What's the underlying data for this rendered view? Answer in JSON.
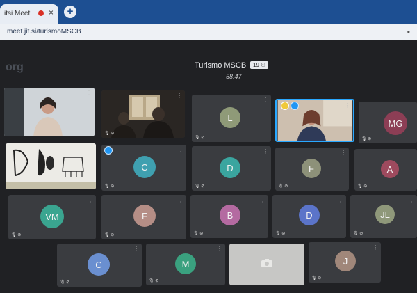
{
  "browser": {
    "tab_title": "itsi Meet",
    "close_icon": "×",
    "new_tab_icon": "+",
    "url": "meet.jit.si/turismoMSCB",
    "menu_icon": "•"
  },
  "meeting": {
    "logo": "org",
    "room_name": "Turismo MSCB",
    "participant_count": "19",
    "elapsed": "58:47",
    "mute_label": "🎙 ⊘",
    "more_icon": "⋮"
  },
  "colors": {
    "accent": "#1d4f92",
    "tile_bg": "#3a3c40",
    "active_border": "#29a8ff"
  },
  "participants": [
    {
      "id": "p1",
      "type": "video",
      "desc": "woman-webcam"
    },
    {
      "id": "p2",
      "type": "video",
      "desc": "dark-room"
    },
    {
      "id": "p3",
      "type": "avatar",
      "initials": "L",
      "color": "#8f9a78"
    },
    {
      "id": "p4",
      "type": "video",
      "desc": "woman-active-speaker"
    },
    {
      "id": "p5",
      "type": "avatar",
      "initials": "MG",
      "color": "#8c3e55"
    },
    {
      "id": "p6",
      "type": "video",
      "desc": "drawing-sheet"
    },
    {
      "id": "p7",
      "type": "avatar",
      "initials": "C",
      "color": "#3fa0b0"
    },
    {
      "id": "p8",
      "type": "avatar",
      "initials": "D",
      "color": "#3aa59f"
    },
    {
      "id": "p9",
      "type": "avatar",
      "initials": "F",
      "color": "#8d9179"
    },
    {
      "id": "p10",
      "type": "avatar",
      "initials": "A",
      "color": "#9e4a5e"
    },
    {
      "id": "p11",
      "type": "avatar",
      "initials": "VM",
      "color": "#3aa590"
    },
    {
      "id": "p12",
      "type": "avatar",
      "initials": "F",
      "color": "#b58e86"
    },
    {
      "id": "p13",
      "type": "avatar",
      "initials": "B",
      "color": "#b46aa1"
    },
    {
      "id": "p14",
      "type": "avatar",
      "initials": "D",
      "color": "#5b74c9"
    },
    {
      "id": "p15",
      "type": "avatar",
      "initials": "JL",
      "color": "#8f987a"
    },
    {
      "id": "p16",
      "type": "avatar",
      "initials": "C",
      "color": "#6a8fd0"
    },
    {
      "id": "p17",
      "type": "avatar",
      "initials": "M",
      "color": "#3aa17f"
    },
    {
      "id": "p18",
      "type": "camera-off",
      "icon": "camera-icon"
    },
    {
      "id": "p19",
      "type": "avatar",
      "initials": "J",
      "color": "#a0877a"
    }
  ]
}
